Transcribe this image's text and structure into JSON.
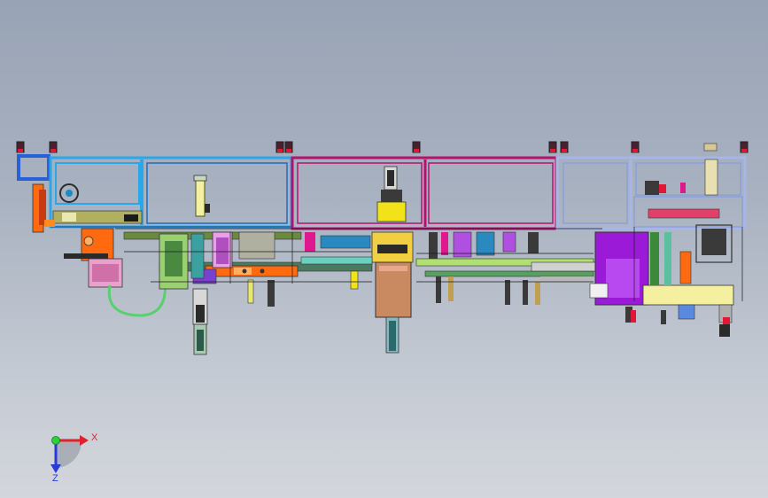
{
  "view": {
    "background_top": "#98a3b5",
    "background_bottom": "#d3d6dc"
  },
  "triad": {
    "x_label": "X",
    "z_label": "Z",
    "x_color": "#e0202a",
    "z_color": "#2a3ad8",
    "origin_color": "#2bd23a"
  },
  "colors": {
    "frame_blue": "#2aa7e8",
    "frame_magenta": "#b5126e",
    "frame_lilac": "#a8b6e6",
    "frame_royal": "#2860d8",
    "cylinder_yellow": "#f2e21a",
    "motor_tan": "#c98a62",
    "purple_unit": "#9a1ad8",
    "orange_arm": "#ff6a10",
    "pink_block": "#e8a0cc",
    "pale_yellow": "#f4f0a0",
    "cable_green": "#58d070"
  }
}
